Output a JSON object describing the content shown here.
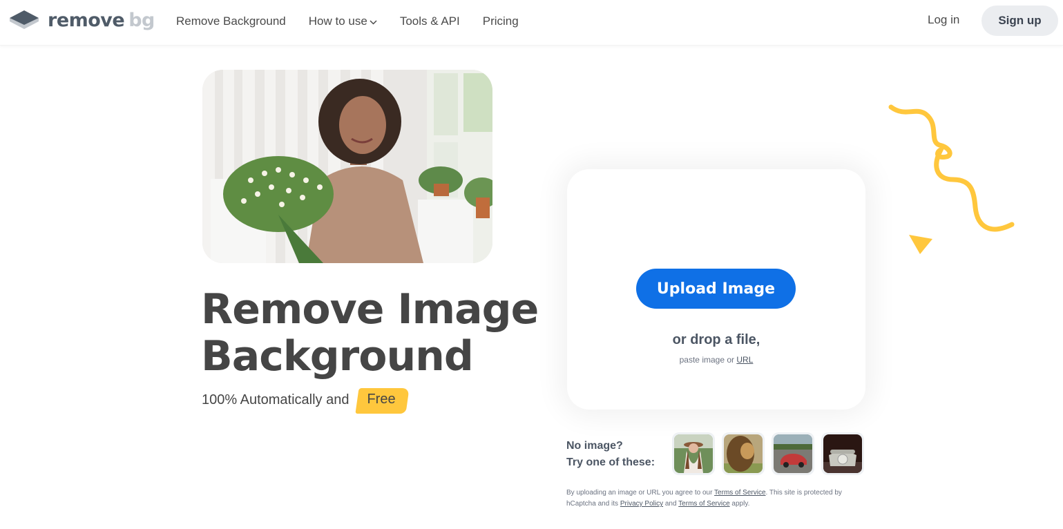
{
  "header": {
    "logo": {
      "word1": "remove",
      "word2": "bg",
      "icon": "layers-icon"
    },
    "nav": [
      {
        "label": "Remove Background"
      },
      {
        "label": "How to use",
        "icon": "chevron-down-icon"
      },
      {
        "label": "Tools & API"
      },
      {
        "label": "Pricing"
      }
    ],
    "login_label": "Log in",
    "signup_label": "Sign up"
  },
  "hero": {
    "image_alt": "Woman holding a bouquet of chamomile flowers",
    "headline_line1": "Remove Image",
    "headline_line2": "Background",
    "subline": "100% Automatically and",
    "free_label": "Free"
  },
  "upload": {
    "button_label": "Upload Image",
    "drop_text": "or drop a file,",
    "paste_prefix": "paste image or",
    "url_link": "URL"
  },
  "samples": {
    "label_line1": "No image?",
    "label_line2": "Try one of these:",
    "items": [
      {
        "alt": "Woman in hat"
      },
      {
        "alt": "Lion"
      },
      {
        "alt": "Red car"
      },
      {
        "alt": "Rotary telephone"
      }
    ]
  },
  "legal": {
    "part1": "By uploading an image or URL you agree to our",
    "tos1": "Terms of Service",
    "part2": ". This site is protected by hCaptcha and its",
    "privacy": "Privacy Policy",
    "part3": "and",
    "tos2": "Terms of Service",
    "part4": "apply."
  },
  "colors": {
    "accent_blue": "#0f70e6",
    "highlight_yellow": "#ffc73d",
    "text_dark": "#454545"
  }
}
